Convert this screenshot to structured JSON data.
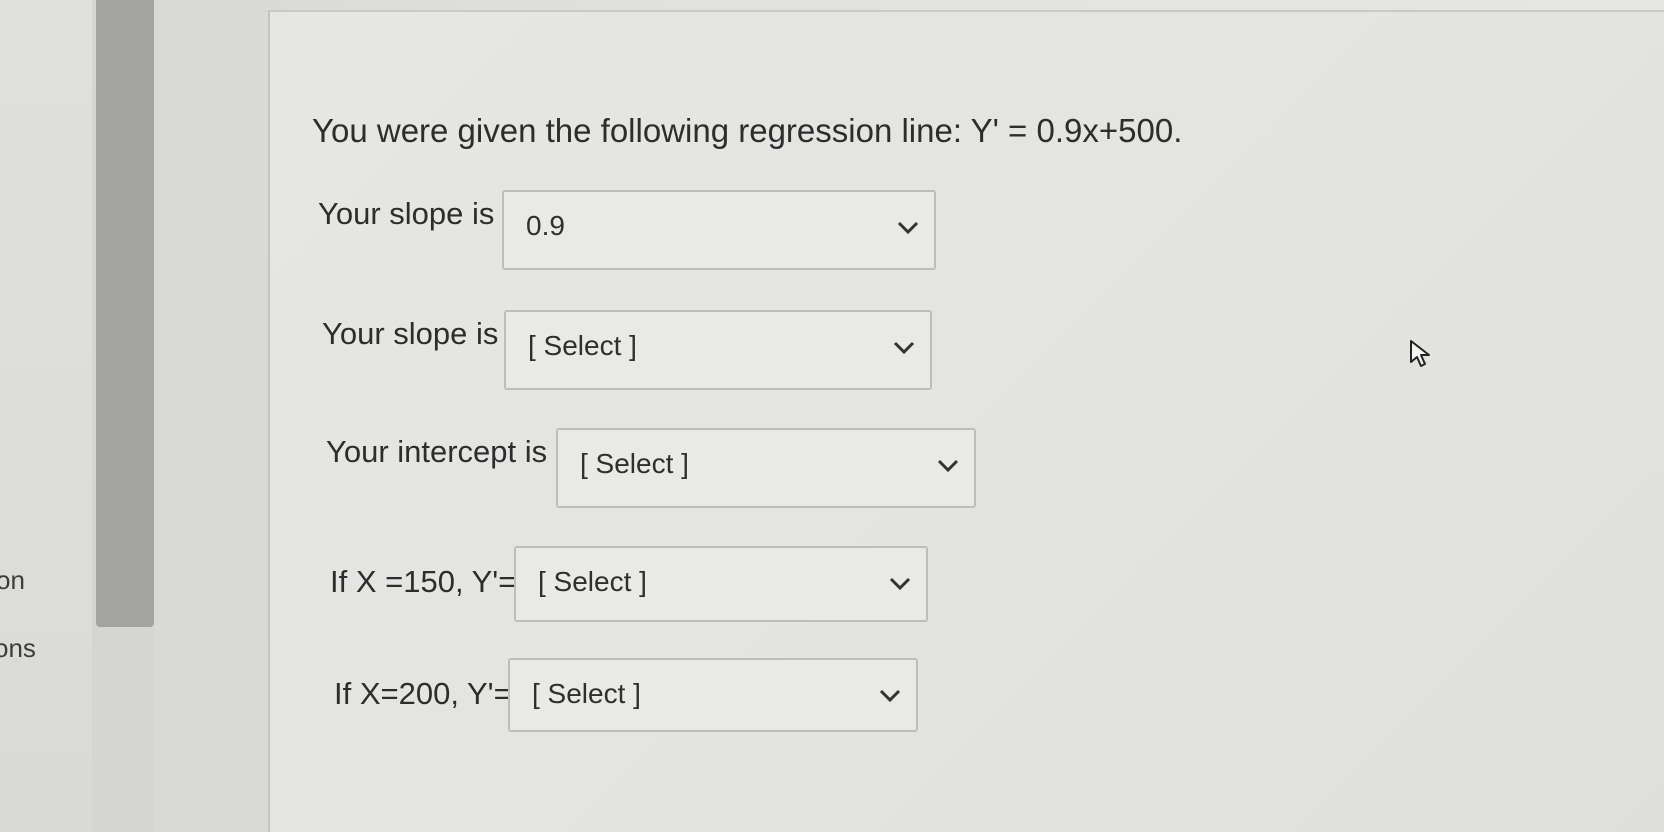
{
  "nav": {
    "item_1": "on",
    "item_2": "ons"
  },
  "question": {
    "text": "You were given the following regression line: Y' = 0.9x+500."
  },
  "fields": [
    {
      "label": "Your slope is",
      "selected": "0.9",
      "icon": "chevron-down-icon"
    },
    {
      "label": "Your slope is",
      "selected": "[ Select ]",
      "icon": "chevron-down-icon"
    },
    {
      "label": "Your intercept is",
      "selected": "[ Select ]",
      "icon": "chevron-down-icon"
    },
    {
      "label": "If X =150, Y'=",
      "selected": "[ Select ]",
      "icon": "chevron-down-icon"
    },
    {
      "label": "If X=200, Y'=",
      "selected": "[ Select ]",
      "icon": "chevron-down-icon"
    }
  ],
  "cursor": {
    "icon": "mouse-pointer-icon"
  },
  "colors": {
    "text": "#2d2d2d",
    "select_border": "#bdbdba",
    "scroll_thumb": "#a3a3a1",
    "background": "#e3e3e0"
  }
}
